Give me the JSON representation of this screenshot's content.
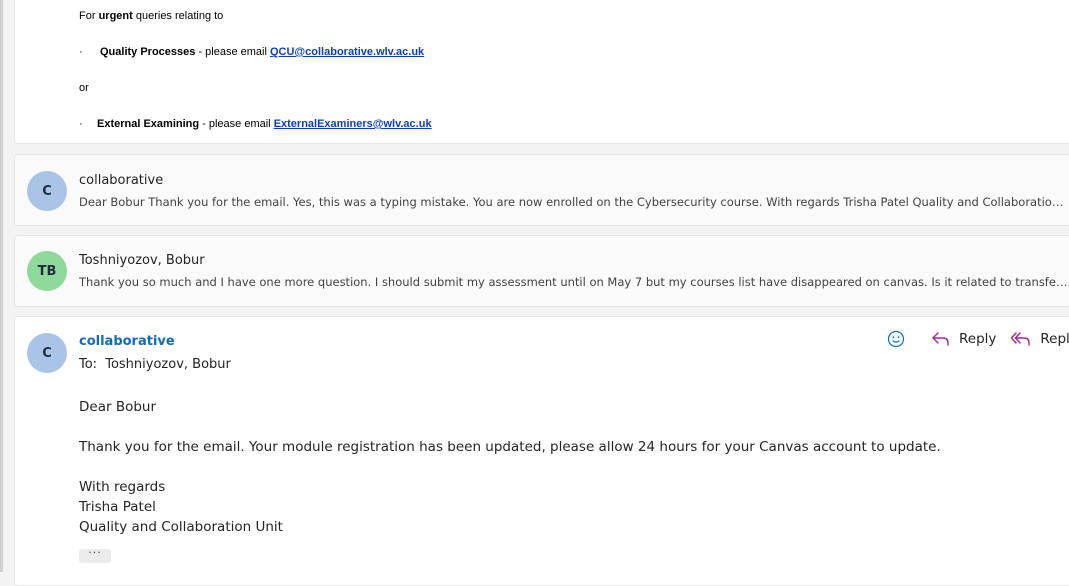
{
  "quoted": {
    "intro_pre": "For ",
    "intro_bold": "urgent",
    "intro_post": " queries relating to",
    "bullet": "·",
    "item1_bold": "Quality Processes",
    "item1_text": " - please email ",
    "item1_link": "QCU@collaborative.wlv.ac.uk",
    "or_text": "or",
    "item2_bold": "External Examining",
    "item2_text": " - please email ",
    "item2_link": "ExternalExaminers@wlv.ac.uk"
  },
  "thread": [
    {
      "initials": "C",
      "avatar_color": "#a9c4e6",
      "sender": "collaborative",
      "preview": "Dear Bobur Thank you for the email. Yes, this was a typing mistake. You are now enrolled on the Cybersecurity course. With regards Trisha Patel Quality and Collaboration Unit"
    },
    {
      "initials": "TB",
      "avatar_color": "#8fd99a",
      "sender": "Toshniyozov, Bobur",
      "preview": "Thank you so much and I have one more question. I should submit my assessment until on May 7 but my courses list have disappeared on canvas. Is it related to transferring or somethin..."
    }
  ],
  "open_message": {
    "initials": "C",
    "avatar_color": "#a9c4e6",
    "sender": "collaborative",
    "to_label": "To:",
    "to_value": "Toshniyozov, Bobur",
    "greeting": "Dear Bobur",
    "body": "Thank you for the email. Your module registration has been updated, please allow 24 hours for your Canvas account to update.",
    "sign1": "With regards",
    "sign2": "Trisha Patel",
    "sign3": "Quality and Collaboration Unit",
    "more": "···",
    "actions": {
      "emoji_icon": "emoji-icon",
      "reply_label": "Reply",
      "reply_all_label": "Reply a"
    }
  },
  "colors": {
    "link": "#0b3fbf",
    "sender_accent": "#0f6cbd",
    "reply_all_icon": "#a4239a"
  }
}
